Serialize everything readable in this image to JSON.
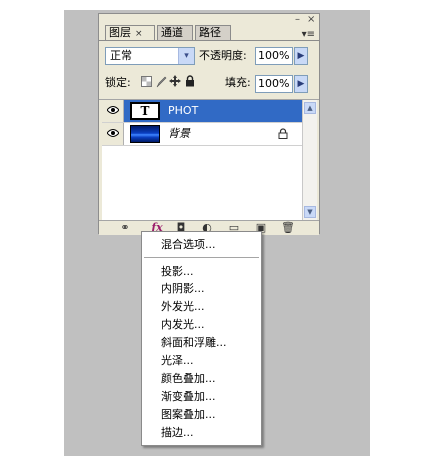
{
  "panel": {
    "tabs": [
      {
        "label": "图层",
        "close": "×"
      },
      {
        "label": "通道"
      },
      {
        "label": "路径"
      }
    ],
    "window_buttons": {
      "minimize": "–",
      "close": "×"
    },
    "menu_glyph": "▾≡",
    "blend_mode": {
      "value": "正常",
      "arrow": "▾"
    },
    "opacity": {
      "label": "不透明度:",
      "value": "100%"
    },
    "lock_label": "锁定:",
    "fill": {
      "label": "填充:",
      "value": "100%"
    },
    "flyout_glyph": "▶",
    "layers": [
      {
        "name": "PHOT",
        "thumb_text": "T",
        "type": "text",
        "selected": true
      },
      {
        "name": "背景",
        "type": "background",
        "locked": true,
        "italic": true
      }
    ],
    "scroll_arrows": {
      "up": "▲",
      "down": "▼"
    },
    "bottom_icons": {
      "link": "⚭",
      "fx": "fx",
      "mask": "◘",
      "adjustment": "◐",
      "group": "▭",
      "new_layer": "▣",
      "delete": "🗑"
    }
  },
  "style_menu": {
    "items_top": [
      "混合选项..."
    ],
    "items": [
      "投影...",
      "内阴影...",
      "外发光...",
      "内发光...",
      "斜面和浮雕...",
      "光泽...",
      "颜色叠加...",
      "渐变叠加...",
      "图案叠加...",
      "描边..."
    ]
  },
  "colors": {
    "selection": "#316ac5",
    "panel_bg": "#ece9d8",
    "backdrop": "#c0c0c0"
  }
}
